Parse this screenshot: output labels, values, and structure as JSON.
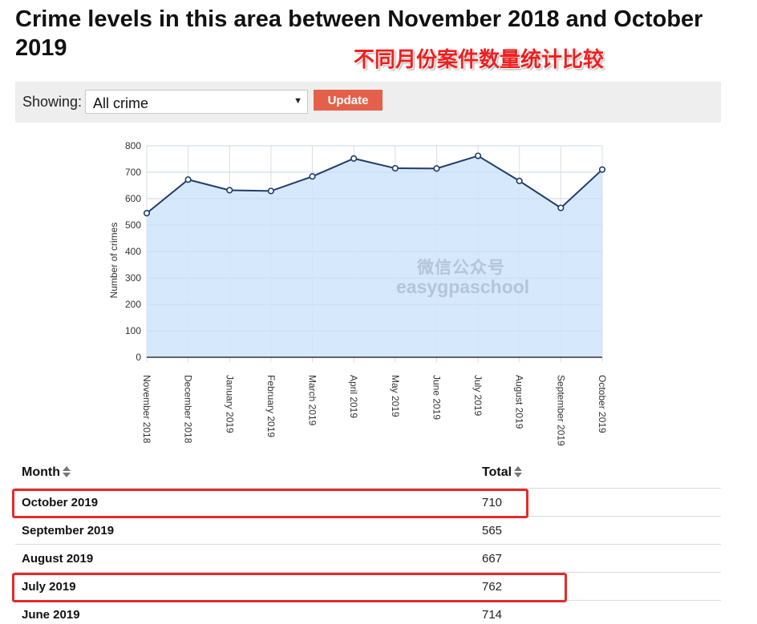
{
  "page": {
    "title": "Crime levels in this area between November 2018 and October 2019",
    "annotation": "不同月份案件数量统计比较"
  },
  "filter": {
    "label": "Showing:",
    "selected": "All crime",
    "update_label": "Update"
  },
  "watermark": {
    "cn": "微信公众号",
    "en": "easygpaschool"
  },
  "chart_data": {
    "type": "area",
    "categories": [
      "November 2018",
      "December 2018",
      "January 2019",
      "February 2019",
      "March 2019",
      "April 2019",
      "May 2019",
      "June 2019",
      "July 2019",
      "August 2019",
      "September 2019",
      "October 2019"
    ],
    "series": [
      {
        "values": [
          545,
          672,
          632,
          629,
          684,
          752,
          715,
          714,
          762,
          667,
          565,
          710
        ]
      }
    ],
    "ylabel": "Number of crimes",
    "xlabel": "",
    "ylim": [
      0,
      800
    ],
    "yticks": [
      0,
      100,
      200,
      300,
      400,
      500,
      600,
      700,
      800
    ],
    "grid": true,
    "colors": {
      "line": "#1f3d6d",
      "fill": "#d2e6fb",
      "grid": "#d8dde6"
    }
  },
  "table": {
    "headers": {
      "month": "Month",
      "total": "Total"
    },
    "rows": [
      {
        "month": "October 2019",
        "total": "710",
        "highlighted": true
      },
      {
        "month": "September 2019",
        "total": "565",
        "highlighted": false
      },
      {
        "month": "August 2019",
        "total": "667",
        "highlighted": false
      },
      {
        "month": "July 2019",
        "total": "762",
        "highlighted": true
      },
      {
        "month": "June 2019",
        "total": "714",
        "highlighted": false
      }
    ],
    "highlight_color": "#e52a2a"
  }
}
